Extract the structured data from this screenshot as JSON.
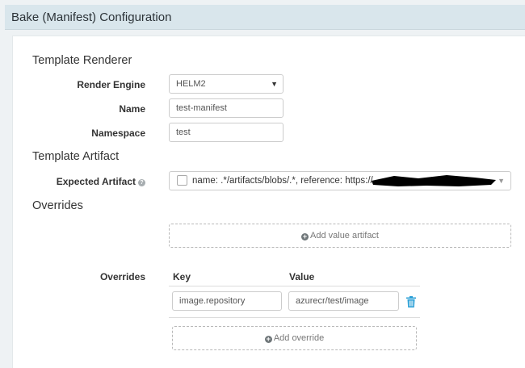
{
  "header": {
    "title": "Bake (Manifest) Configuration"
  },
  "template_renderer": {
    "section_title": "Template Renderer",
    "render_engine": {
      "label": "Render Engine",
      "value": "HELM2"
    },
    "name": {
      "label": "Name",
      "value": "test-manifest"
    },
    "namespace": {
      "label": "Namespace",
      "value": "test"
    }
  },
  "template_artifact": {
    "section_title": "Template Artifact",
    "expected_artifact": {
      "label": "Expected Artifact",
      "value": "name: .*/artifacts/blobs/.*, reference: https://"
    }
  },
  "overrides": {
    "section_title": "Overrides",
    "add_value_artifact": "Add value artifact",
    "label": "Overrides",
    "columns": [
      "Key",
      "Value"
    ],
    "rows": [
      {
        "key": "image.repository",
        "value": "azurecr/test/image"
      }
    ],
    "add_override": "Add override"
  },
  "colors": {
    "header_bg": "#d9e6ec",
    "trash_icon": "#2a9fd6"
  }
}
